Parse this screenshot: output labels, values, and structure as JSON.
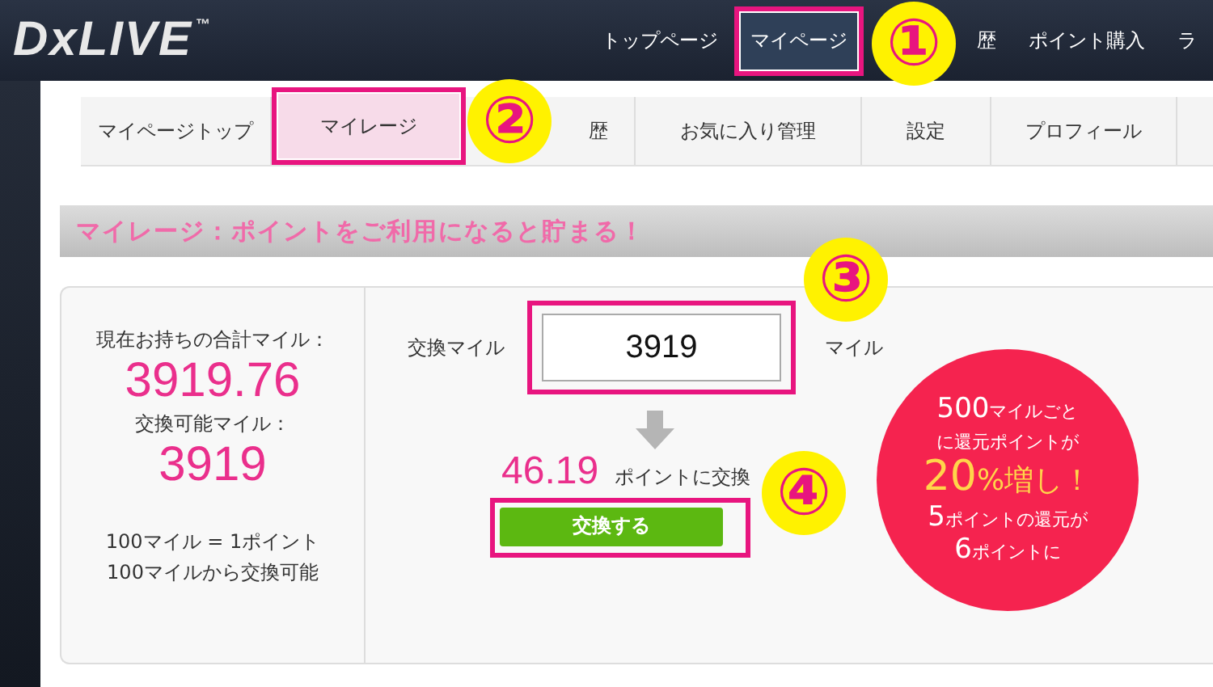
{
  "header": {
    "logo": "DxLIVE",
    "logo_mark": "™",
    "nav": [
      {
        "label": "トップページ",
        "selected": false,
        "highlighted": false
      },
      {
        "label": "マイページ",
        "selected": true,
        "highlighted": true,
        "annotation": "①"
      },
      {
        "label": "歴",
        "selected": false,
        "highlighted": false
      },
      {
        "label": "ポイント購入",
        "selected": false,
        "highlighted": false
      },
      {
        "label": "ラ",
        "selected": false,
        "highlighted": false
      }
    ]
  },
  "tabs": [
    {
      "label": "マイページトップ",
      "selected": false,
      "highlighted": false
    },
    {
      "label": "マイレージ",
      "selected": true,
      "highlighted": true,
      "annotation": "②"
    },
    {
      "label": "歴",
      "selected": false,
      "highlighted": false
    },
    {
      "label": "お気に入り管理",
      "selected": false,
      "highlighted": false
    },
    {
      "label": "設定",
      "selected": false,
      "highlighted": false
    },
    {
      "label": "プロフィール",
      "selected": false,
      "highlighted": false
    }
  ],
  "section_title": "マイレージ：ポイントをご利用になると貯まる！",
  "summary": {
    "total_label": "現在お持ちの合計マイル：",
    "total_value": "3919.76",
    "exchangeable_label": "交換可能マイル：",
    "exchangeable_value": "3919",
    "rate": "100マイル = 1ポイント",
    "minimum": "100マイルから交換可能"
  },
  "exchange": {
    "label": "交換マイル",
    "value": "3919",
    "unit": "マイル",
    "input_highlighted": true,
    "input_annotation": "③",
    "result": "46.19",
    "result_unit": "ポイントに交換",
    "button": "交換する",
    "button_highlighted": true,
    "button_annotation": "④"
  },
  "promo": [
    {
      "parts": [
        {
          "text": "500",
          "kind": "big"
        },
        {
          "text": "マイルごと",
          "kind": "small"
        }
      ]
    },
    {
      "parts": [
        {
          "text": "に還元ポイントが",
          "kind": "small"
        }
      ]
    },
    {
      "parts": [
        {
          "text": "20",
          "kind": "accent_big"
        },
        {
          "text": "%増し！",
          "kind": "accent"
        }
      ]
    },
    {
      "parts": [
        {
          "text": "5",
          "kind": "big"
        },
        {
          "text": "ポイントの還元が",
          "kind": "small"
        }
      ]
    },
    {
      "parts": [
        {
          "text": "6",
          "kind": "big"
        },
        {
          "text": "ポイントに",
          "kind": "small"
        }
      ]
    }
  ]
}
